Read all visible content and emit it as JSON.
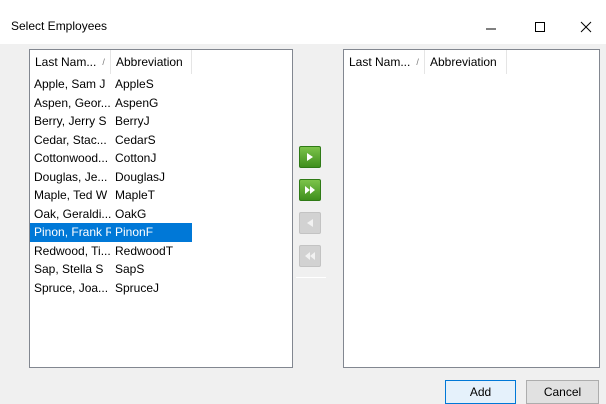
{
  "window": {
    "title": "Select Employees",
    "controls": [
      "minimize",
      "maximize",
      "close"
    ]
  },
  "left_list": {
    "columns": [
      "Last Nam...",
      "Abbreviation"
    ],
    "sort_indicator": "/",
    "rows": [
      [
        "Apple, Sam J",
        "AppleS"
      ],
      [
        "Aspen, Geor...",
        "AspenG"
      ],
      [
        "Berry, Jerry S",
        "BerryJ"
      ],
      [
        "Cedar, Stac...",
        "CedarS"
      ],
      [
        "Cottonwood...",
        "CottonJ"
      ],
      [
        "Douglas, Je...",
        "DouglasJ"
      ],
      [
        "Maple, Ted W",
        "MapleT"
      ],
      [
        "Oak, Geraldi...",
        "OakG"
      ],
      [
        "Pinon, Frank R",
        "PinonF"
      ],
      [
        "Redwood, Ti...",
        "RedwoodT"
      ],
      [
        "Sap, Stella S",
        "SapS"
      ],
      [
        "Spruce, Joa...",
        "SpruceJ"
      ]
    ],
    "selected_index": 8
  },
  "right_list": {
    "columns": [
      "Last Nam...",
      "Abbreviation"
    ],
    "sort_indicator": "/",
    "rows": []
  },
  "move_buttons": [
    {
      "name": "move-right",
      "icon": "play-right-icon",
      "enabled": true
    },
    {
      "name": "move-all-right",
      "icon": "double-right-icon",
      "enabled": true
    },
    {
      "name": "move-left",
      "icon": "play-left-icon",
      "enabled": false
    },
    {
      "name": "move-all-left",
      "icon": "double-left-icon",
      "enabled": false
    }
  ],
  "buttons": {
    "add": "Add",
    "cancel": "Cancel"
  },
  "colors": {
    "selection": "#0078d7",
    "enabled_move": "#4caf2a",
    "disabled_move": "#d2d2d2"
  }
}
